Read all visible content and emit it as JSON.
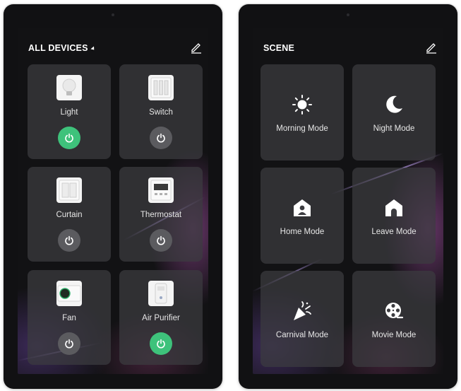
{
  "devices_screen": {
    "title": "ALL DEVICES",
    "devices": [
      {
        "label": "Light",
        "icon": "light-bulb-icon",
        "power_on": true
      },
      {
        "label": "Switch",
        "icon": "wall-switch-icon",
        "power_on": false
      },
      {
        "label": "Curtain",
        "icon": "curtain-icon",
        "power_on": false
      },
      {
        "label": "Thermostat",
        "icon": "thermostat-icon",
        "power_on": false
      },
      {
        "label": "Fan",
        "icon": "fan-icon",
        "power_on": false
      },
      {
        "label": "Air Purifier",
        "icon": "air-purifier-icon",
        "power_on": true
      }
    ]
  },
  "scene_screen": {
    "title": "SCENE",
    "scenes": [
      {
        "label": "Morning Mode",
        "icon": "sun-icon"
      },
      {
        "label": "Night Mode",
        "icon": "moon-icon"
      },
      {
        "label": "Home Mode",
        "icon": "home-person-icon"
      },
      {
        "label": "Leave Mode",
        "icon": "home-door-icon"
      },
      {
        "label": "Carnival Mode",
        "icon": "party-popper-icon"
      },
      {
        "label": "Movie Mode",
        "icon": "film-reel-icon"
      }
    ]
  },
  "colors": {
    "power_on": "#3ec27b",
    "power_off": "#5b5b5f",
    "tile": "#3c3c40",
    "background": "#121214"
  }
}
